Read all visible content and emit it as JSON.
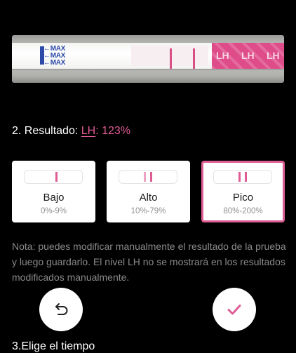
{
  "strip_photo": {
    "marker_text": "MAX",
    "handle_text": "LH"
  },
  "result": {
    "prefix": "2. Resultado: ",
    "link_label": "LH",
    "separator": ": ",
    "value": "123%"
  },
  "levels": [
    {
      "label": "Bajo",
      "range": "0%-9%"
    },
    {
      "label": "Alto",
      "range": "10%-79%"
    },
    {
      "label": "Pico",
      "range": "80%-200%"
    }
  ],
  "selected_level": "Pico",
  "note": "Nota: puedes modificar manualmente el resultado de la prueba y luego guardarlo. El nivel LH no se mostrará en los resultados modificados manualmente.",
  "next_section": "3.Elige el tiempo",
  "icons": {
    "undo": "undo-arrow-icon",
    "confirm": "checkmark-icon"
  },
  "colors": {
    "accent": "#de5d95",
    "background": "#000000",
    "note_text": "#8a8a8a"
  }
}
